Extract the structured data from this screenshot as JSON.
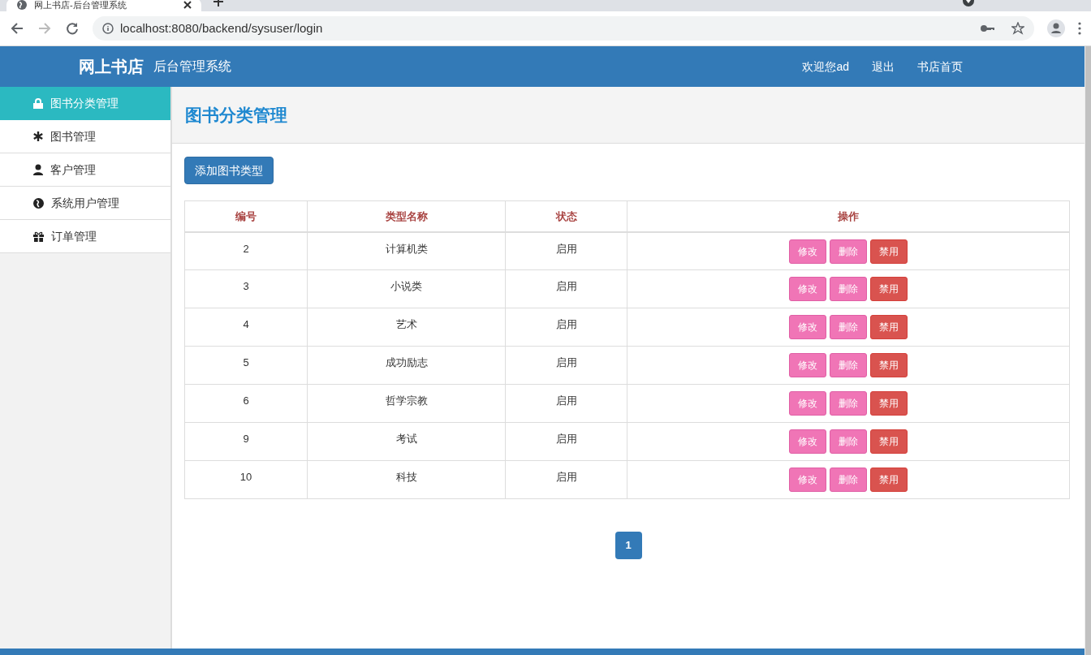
{
  "browser": {
    "tab_title": "网上书店-后台管理系统",
    "url": "localhost:8080/backend/sysuser/login"
  },
  "header": {
    "brand": "网上书店",
    "subtitle": "后台管理系统",
    "links": [
      "欢迎您ad",
      "退出",
      "书店首页"
    ]
  },
  "sidebar": {
    "items": [
      {
        "label": "图书分类管理",
        "selected": true
      },
      {
        "label": "图书管理",
        "selected": false
      },
      {
        "label": "客户管理",
        "selected": false
      },
      {
        "label": "系统用户管理",
        "selected": false
      },
      {
        "label": "订单管理",
        "selected": false
      }
    ]
  },
  "page_title": "图书分类管理",
  "add_button": "添加图书类型",
  "table": {
    "columns": [
      "编号",
      "类型名称",
      "状态",
      "操作"
    ],
    "rows": [
      {
        "id": "2",
        "name": "计算机类",
        "status": "启用",
        "actions": [
          "修改",
          "删除",
          "禁用"
        ]
      },
      {
        "id": "3",
        "name": "小说类",
        "status": "启用",
        "actions": [
          "修改",
          "删除",
          "禁用"
        ]
      },
      {
        "id": "4",
        "name": "艺术",
        "status": "启用",
        "actions": [
          "修改",
          "删除",
          "禁用"
        ]
      },
      {
        "id": "5",
        "name": "成功励志",
        "status": "启用",
        "actions": [
          "修改",
          "删除",
          "禁用"
        ]
      },
      {
        "id": "6",
        "name": "哲学宗教",
        "status": "启用",
        "actions": [
          "修改",
          "删除",
          "禁用"
        ]
      },
      {
        "id": "9",
        "name": "考试",
        "status": "启用",
        "actions": [
          "修改",
          "删除",
          "禁用"
        ]
      },
      {
        "id": "10",
        "name": "科技",
        "status": "启用",
        "actions": [
          "修改",
          "删除",
          "禁用"
        ]
      }
    ]
  },
  "pagination": [
    {
      "label": "1",
      "selected": true
    }
  ]
}
